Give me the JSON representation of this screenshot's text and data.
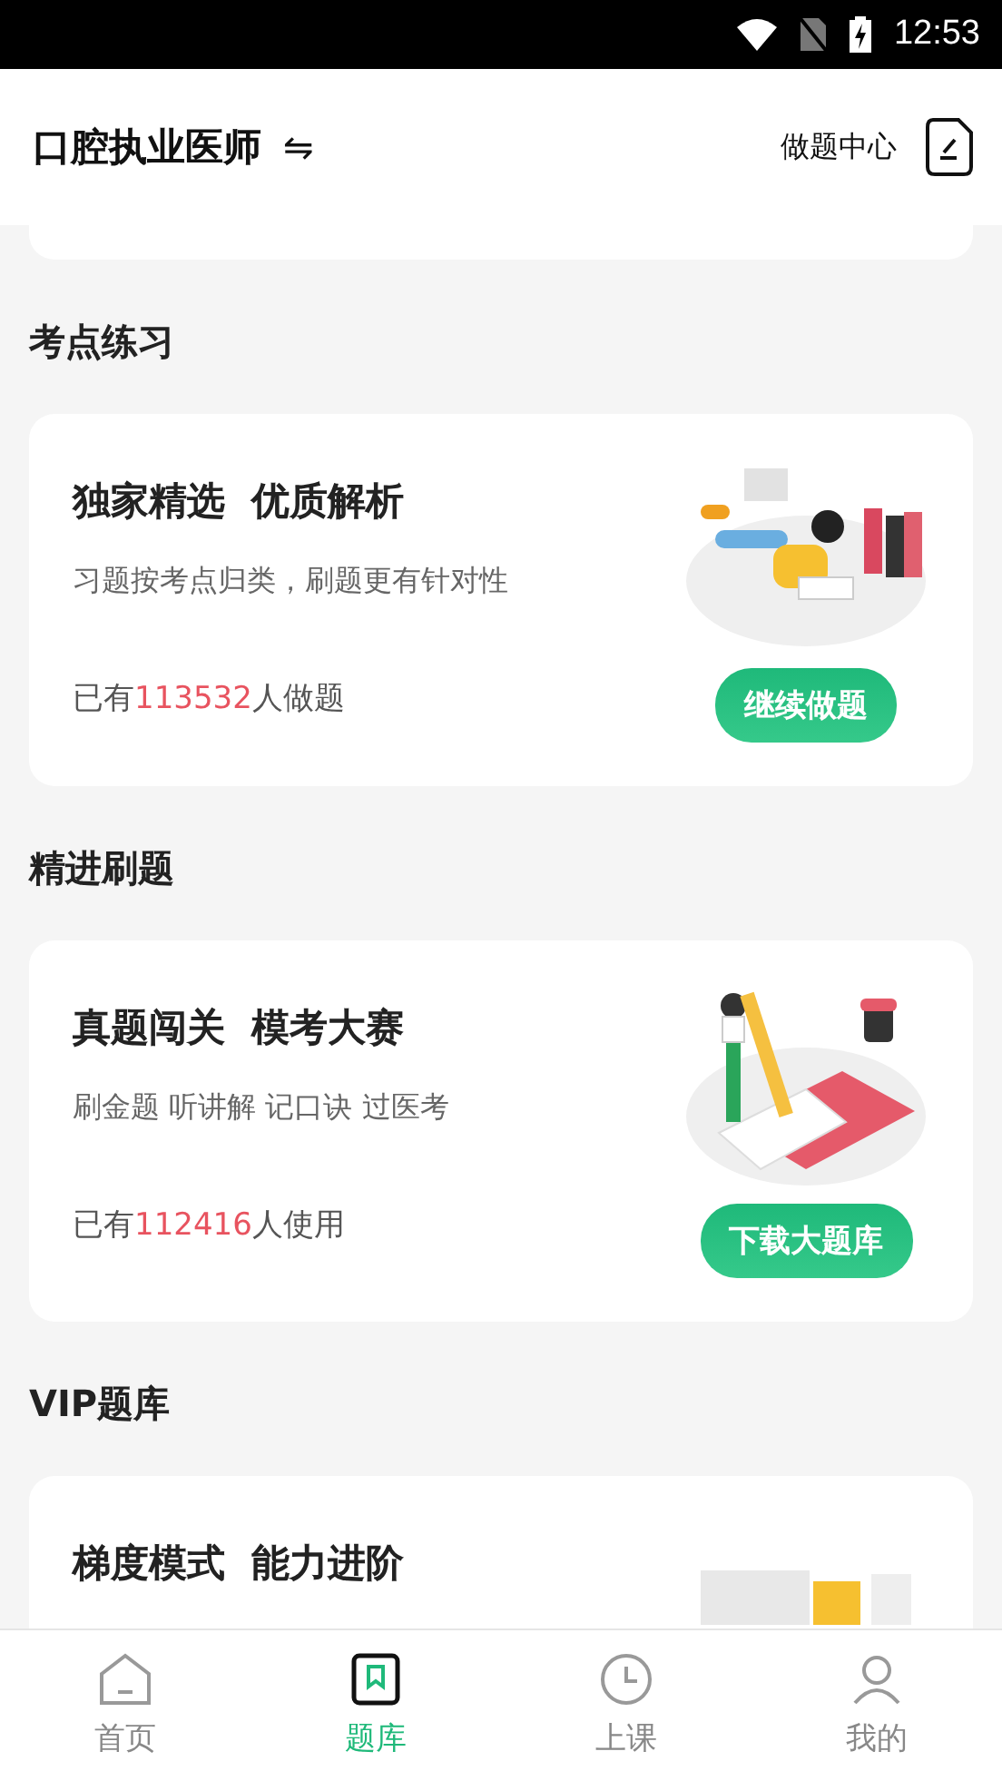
{
  "status_bar": {
    "time": "12:53"
  },
  "header": {
    "title": "口腔执业医师",
    "switch_icon": "⇋",
    "practice_center": "做题中心"
  },
  "sections": [
    {
      "title": "考点练习",
      "card": {
        "kind": "reader",
        "heading": "独家精选  优质解析",
        "subtitle": "习题按考点归类，刷题更有针对性",
        "count_prefix": "已有",
        "count": "113532",
        "count_suffix": "人做题",
        "button": "继续做题"
      }
    },
    {
      "title": "精进刷题",
      "card": {
        "kind": "writer",
        "heading": "真题闯关  模考大赛",
        "subtitle": "刷金题 听讲解 记口诀 过医考",
        "count_prefix": "已有",
        "count": "112416",
        "count_suffix": "人使用",
        "button": "下载大题库"
      }
    },
    {
      "title": "VIP题库",
      "card": {
        "kind": "folder",
        "heading": "梯度模式  能力进阶"
      }
    }
  ],
  "bottom_nav": [
    {
      "label": "首页",
      "kind": "home",
      "selected": false
    },
    {
      "label": "题库",
      "kind": "bank",
      "selected": true
    },
    {
      "label": "上课",
      "kind": "clock",
      "selected": false
    },
    {
      "label": "我的",
      "kind": "me",
      "selected": false
    }
  ]
}
